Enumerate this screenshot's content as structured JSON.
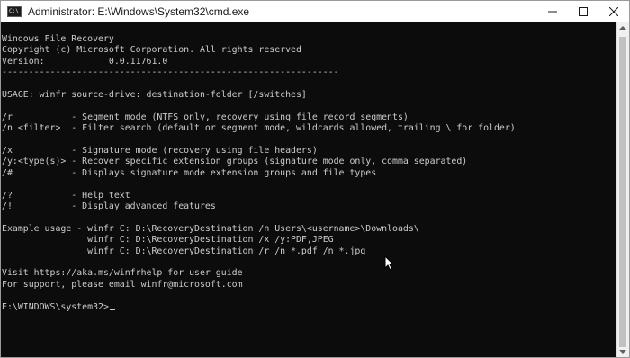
{
  "window": {
    "title": "Administrator: E:\\Windows\\System32\\cmd.exe",
    "icon_glyph": "C:\\",
    "controls": [
      {
        "name": "minimize-icon"
      },
      {
        "name": "maximize-icon"
      },
      {
        "name": "close-icon"
      }
    ]
  },
  "console": {
    "lines": [
      "Windows File Recovery",
      "Copyright (c) Microsoft Corporation. All rights reserved",
      "Version:            0.0.11761.0",
      "---------------------------------------------------------------",
      "",
      "USAGE: winfr source-drive: destination-folder [/switches]",
      "",
      "/r           - Segment mode (NTFS only, recovery using file record segments)",
      "/n <filter>  - Filter search (default or segment mode, wildcards allowed, trailing \\ for folder)",
      "",
      "/x           - Signature mode (recovery using file headers)",
      "/y:<type(s)> - Recover specific extension groups (signature mode only, comma separated)",
      "/#           - Displays signature mode extension groups and file types",
      "",
      "/?           - Help text",
      "/!           - Display advanced features",
      "",
      "Example usage - winfr C: D:\\RecoveryDestination /n Users\\<username>\\Downloads\\",
      "                winfr C: D:\\RecoveryDestination /x /y:PDF,JPEG",
      "                winfr C: D:\\RecoveryDestination /r /n *.pdf /n *.jpg",
      "",
      "Visit https://aka.ms/winfrhelp for user guide",
      "For support, please email winfr@microsoft.com",
      "",
      "E:\\WINDOWS\\system32>"
    ]
  },
  "colors": {
    "console_bg": "#0c0c0c",
    "console_fg": "#cccccc",
    "titlebar_bg": "#ffffff"
  }
}
